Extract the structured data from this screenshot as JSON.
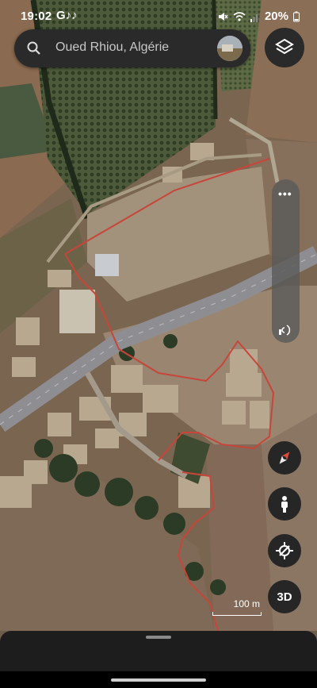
{
  "status_bar": {
    "time": "19:02",
    "app_icons": "G♪♪",
    "battery": "20%"
  },
  "search": {
    "text": "Oued Rhiou, Algérie"
  },
  "map": {
    "scale_label": "100 m",
    "boundary_color": "#c8453a",
    "road_color": "#9a9aa0"
  },
  "controls": {
    "rail_menu": "•••",
    "three_d_label": "3D"
  },
  "icons": [
    "search-icon",
    "layers-icon",
    "more-icon",
    "sound-icon",
    "compass-icon",
    "street-view-icon",
    "location-icon"
  ]
}
